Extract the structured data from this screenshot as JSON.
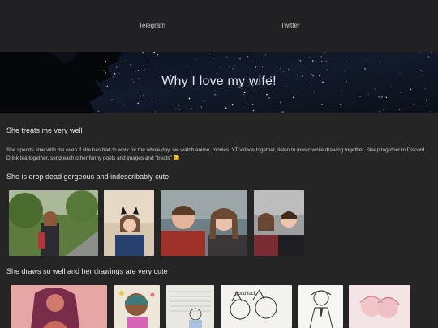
{
  "nav": {
    "links": [
      {
        "label": "Telegram"
      },
      {
        "label": "Twitter"
      }
    ]
  },
  "hero": {
    "title": "Why I love my wife!"
  },
  "sections": [
    {
      "heading": "She treats me very well",
      "body": "She spends time with me even if she has had to work for the whole day, we watch anime, movies, YT videos together, listen to music while drawing together. Sleep together in Discord Drink tea together, send each other funny posts and images and \"treats\" 😊"
    },
    {
      "heading": "She is drop dead gorgeous and indescribably cute"
    },
    {
      "heading": "She draws so well and her drawings are very cute"
    }
  ],
  "colors": {
    "page_bg": "#252526",
    "nav_bg": "#212123",
    "hero_bg": "#0a0e16"
  }
}
